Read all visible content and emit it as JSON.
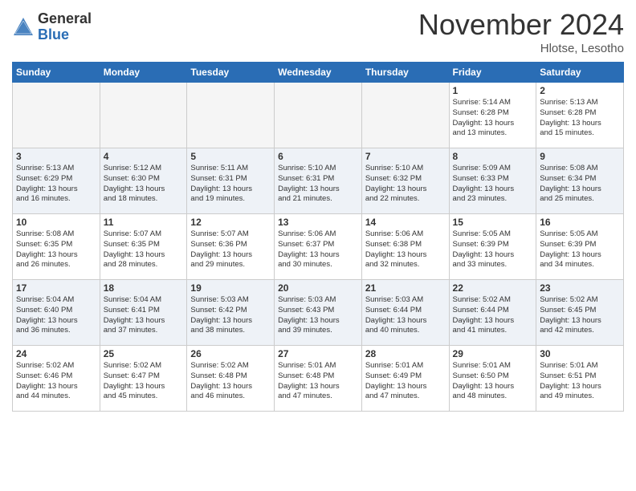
{
  "header": {
    "logo_general": "General",
    "logo_blue": "Blue",
    "month_title": "November 2024",
    "location": "Hlotse, Lesotho"
  },
  "days_of_week": [
    "Sunday",
    "Monday",
    "Tuesday",
    "Wednesday",
    "Thursday",
    "Friday",
    "Saturday"
  ],
  "weeks": [
    [
      {
        "day": "",
        "empty": true
      },
      {
        "day": "",
        "empty": true
      },
      {
        "day": "",
        "empty": true
      },
      {
        "day": "",
        "empty": true
      },
      {
        "day": "",
        "empty": true
      },
      {
        "day": "1",
        "sunrise": "5:14 AM",
        "sunset": "6:28 PM",
        "daylight": "13 hours and 13 minutes."
      },
      {
        "day": "2",
        "sunrise": "5:13 AM",
        "sunset": "6:28 PM",
        "daylight": "13 hours and 15 minutes."
      }
    ],
    [
      {
        "day": "3",
        "sunrise": "5:13 AM",
        "sunset": "6:29 PM",
        "daylight": "13 hours and 16 minutes."
      },
      {
        "day": "4",
        "sunrise": "5:12 AM",
        "sunset": "6:30 PM",
        "daylight": "13 hours and 18 minutes."
      },
      {
        "day": "5",
        "sunrise": "5:11 AM",
        "sunset": "6:31 PM",
        "daylight": "13 hours and 19 minutes."
      },
      {
        "day": "6",
        "sunrise": "5:10 AM",
        "sunset": "6:31 PM",
        "daylight": "13 hours and 21 minutes."
      },
      {
        "day": "7",
        "sunrise": "5:10 AM",
        "sunset": "6:32 PM",
        "daylight": "13 hours and 22 minutes."
      },
      {
        "day": "8",
        "sunrise": "5:09 AM",
        "sunset": "6:33 PM",
        "daylight": "13 hours and 23 minutes."
      },
      {
        "day": "9",
        "sunrise": "5:08 AM",
        "sunset": "6:34 PM",
        "daylight": "13 hours and 25 minutes."
      }
    ],
    [
      {
        "day": "10",
        "sunrise": "5:08 AM",
        "sunset": "6:35 PM",
        "daylight": "13 hours and 26 minutes."
      },
      {
        "day": "11",
        "sunrise": "5:07 AM",
        "sunset": "6:35 PM",
        "daylight": "13 hours and 28 minutes."
      },
      {
        "day": "12",
        "sunrise": "5:07 AM",
        "sunset": "6:36 PM",
        "daylight": "13 hours and 29 minutes."
      },
      {
        "day": "13",
        "sunrise": "5:06 AM",
        "sunset": "6:37 PM",
        "daylight": "13 hours and 30 minutes."
      },
      {
        "day": "14",
        "sunrise": "5:06 AM",
        "sunset": "6:38 PM",
        "daylight": "13 hours and 32 minutes."
      },
      {
        "day": "15",
        "sunrise": "5:05 AM",
        "sunset": "6:39 PM",
        "daylight": "13 hours and 33 minutes."
      },
      {
        "day": "16",
        "sunrise": "5:05 AM",
        "sunset": "6:39 PM",
        "daylight": "13 hours and 34 minutes."
      }
    ],
    [
      {
        "day": "17",
        "sunrise": "5:04 AM",
        "sunset": "6:40 PM",
        "daylight": "13 hours and 36 minutes."
      },
      {
        "day": "18",
        "sunrise": "5:04 AM",
        "sunset": "6:41 PM",
        "daylight": "13 hours and 37 minutes."
      },
      {
        "day": "19",
        "sunrise": "5:03 AM",
        "sunset": "6:42 PM",
        "daylight": "13 hours and 38 minutes."
      },
      {
        "day": "20",
        "sunrise": "5:03 AM",
        "sunset": "6:43 PM",
        "daylight": "13 hours and 39 minutes."
      },
      {
        "day": "21",
        "sunrise": "5:03 AM",
        "sunset": "6:44 PM",
        "daylight": "13 hours and 40 minutes."
      },
      {
        "day": "22",
        "sunrise": "5:02 AM",
        "sunset": "6:44 PM",
        "daylight": "13 hours and 41 minutes."
      },
      {
        "day": "23",
        "sunrise": "5:02 AM",
        "sunset": "6:45 PM",
        "daylight": "13 hours and 42 minutes."
      }
    ],
    [
      {
        "day": "24",
        "sunrise": "5:02 AM",
        "sunset": "6:46 PM",
        "daylight": "13 hours and 44 minutes."
      },
      {
        "day": "25",
        "sunrise": "5:02 AM",
        "sunset": "6:47 PM",
        "daylight": "13 hours and 45 minutes."
      },
      {
        "day": "26",
        "sunrise": "5:02 AM",
        "sunset": "6:48 PM",
        "daylight": "13 hours and 46 minutes."
      },
      {
        "day": "27",
        "sunrise": "5:01 AM",
        "sunset": "6:48 PM",
        "daylight": "13 hours and 47 minutes."
      },
      {
        "day": "28",
        "sunrise": "5:01 AM",
        "sunset": "6:49 PM",
        "daylight": "13 hours and 47 minutes."
      },
      {
        "day": "29",
        "sunrise": "5:01 AM",
        "sunset": "6:50 PM",
        "daylight": "13 hours and 48 minutes."
      },
      {
        "day": "30",
        "sunrise": "5:01 AM",
        "sunset": "6:51 PM",
        "daylight": "13 hours and 49 minutes."
      }
    ]
  ]
}
